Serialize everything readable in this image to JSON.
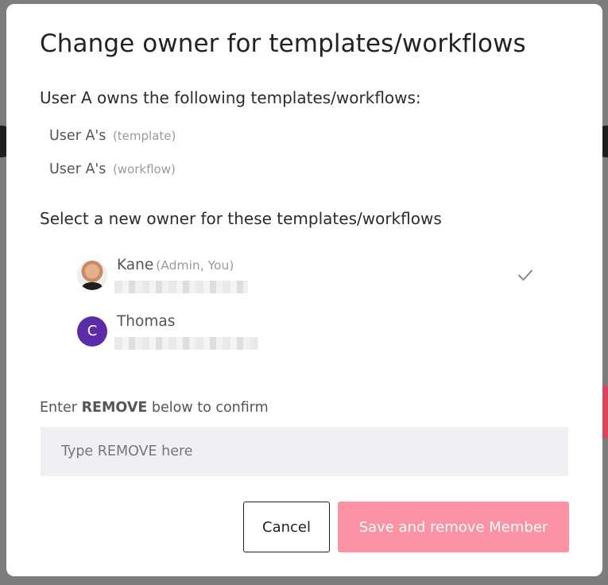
{
  "modal": {
    "title": "Change owner for templates/workflows",
    "owned_heading": "User A owns the following templates/workflows:",
    "owned_items": [
      {
        "name": "User A's",
        "type": "(template)"
      },
      {
        "name": "User A's",
        "type": "(workflow)"
      }
    ],
    "select_heading": "Select a new owner for these templates/workflows",
    "members": [
      {
        "name": "Kane",
        "role": "(Admin, You)",
        "avatar": "photo",
        "selected": true,
        "icon": "check-icon"
      },
      {
        "name": "Thomas",
        "role": "",
        "avatar_letter": "C",
        "avatar_color": "#5a2ca8",
        "selected": false
      }
    ],
    "confirm": {
      "label_prefix": "Enter",
      "label_keyword": "REMOVE",
      "label_suffix": "below to confirm",
      "placeholder": "Type REMOVE here",
      "value": ""
    },
    "buttons": {
      "cancel_label": "Cancel",
      "save_label": "Save and remove Member"
    }
  },
  "colors": {
    "accent_disabled": "#fb93a4",
    "avatar_purple": "#5a2ca8",
    "input_bg": "#eef0f3"
  }
}
